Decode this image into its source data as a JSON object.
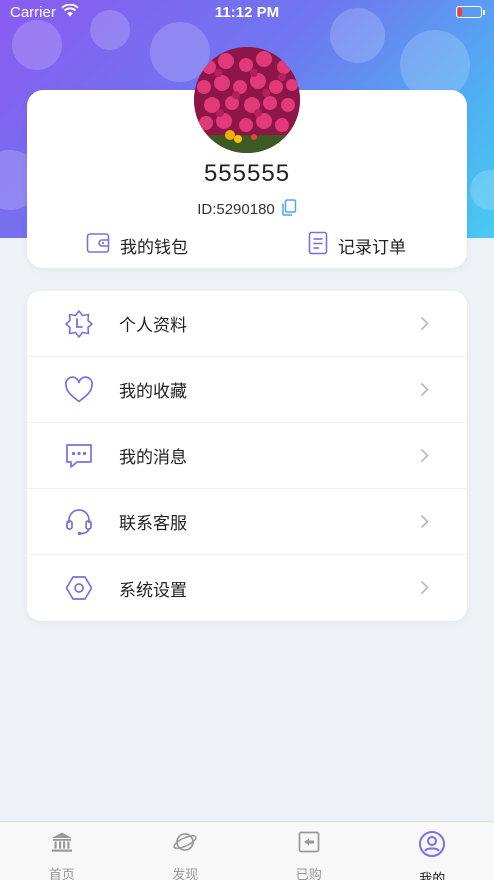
{
  "status_bar": {
    "carrier": "Carrier",
    "time": "11:12 PM"
  },
  "profile": {
    "username": "555555",
    "user_id": "ID:5290180"
  },
  "quick_actions": [
    {
      "label": "我的钱包",
      "icon": "wallet-icon"
    },
    {
      "label": "记录订单",
      "icon": "order-record-icon"
    }
  ],
  "menu": {
    "items": [
      {
        "label": "个人资料",
        "icon": "profile-badge-icon"
      },
      {
        "label": "我的收藏",
        "icon": "heart-icon"
      },
      {
        "label": "我的消息",
        "icon": "message-icon"
      },
      {
        "label": "联系客服",
        "icon": "headset-icon"
      },
      {
        "label": "系统设置",
        "icon": "settings-hexagon-icon"
      }
    ]
  },
  "tabs": [
    {
      "label": "首页",
      "icon": "bank-icon",
      "active": false
    },
    {
      "label": "发现",
      "icon": "planet-icon",
      "active": false
    },
    {
      "label": "已购",
      "icon": "purchased-icon",
      "active": false
    },
    {
      "label": "我的",
      "icon": "user-circle-icon",
      "active": true
    }
  ],
  "colors": {
    "accent": "#7b6fe0",
    "hero_gradient_start": "#8a5cf0",
    "hero_gradient_end": "#49c9f2",
    "copy_icon": "#4da3f5",
    "battery_low": "#ff3b30"
  }
}
